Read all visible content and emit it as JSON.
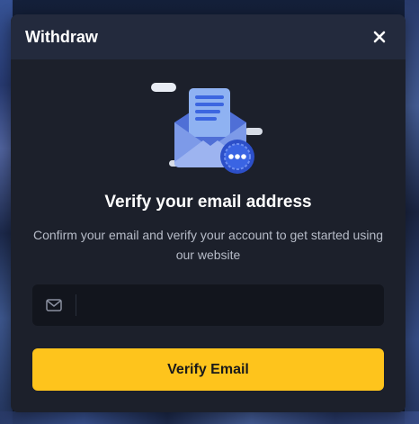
{
  "modal": {
    "title": "Withdraw",
    "close_icon": "close-icon",
    "illustration": "email-envelope-illustration",
    "heading": "Verify your email address",
    "subtext": "Confirm your email and verify your account to get started using our website",
    "email": {
      "icon": "mail-icon",
      "value": "",
      "placeholder": ""
    },
    "verify_label": "Verify Email"
  },
  "colors": {
    "header_bg": "#232a3d",
    "modal_bg": "#1c202b",
    "accent": "#fec41c",
    "input_bg": "#12151d"
  }
}
